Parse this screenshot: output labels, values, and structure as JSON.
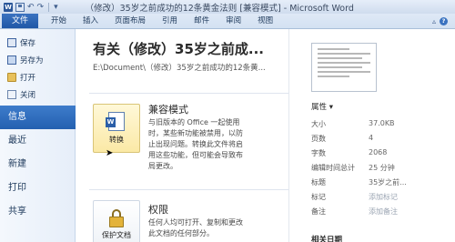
{
  "window": {
    "title": "（修改）35岁之前成功的12条黄金法则 [兼容模式] - Microsoft Word",
    "qat_icons": [
      "word-icon",
      "save-icon",
      "undo-icon",
      "redo-icon",
      "customize-icon"
    ]
  },
  "ribbon": {
    "file_tab": "文件",
    "tabs": [
      "开始",
      "插入",
      "页面布局",
      "引用",
      "邮件",
      "审阅",
      "视图"
    ]
  },
  "nav": {
    "commands": [
      {
        "label": "保存",
        "icon": "save-icon"
      },
      {
        "label": "另存为",
        "icon": "save-as-icon"
      },
      {
        "label": "打开",
        "icon": "open-folder-icon"
      },
      {
        "label": "关闭",
        "icon": "close-document-icon"
      }
    ],
    "tabs": [
      "信息",
      "最近",
      "新建",
      "打印",
      "共享"
    ],
    "active_tab": "信息"
  },
  "main": {
    "doc_title": "有关（修改）35岁之前成...",
    "doc_path": "E:\\Document\\（修改）35岁之前成功的12条黄...",
    "compat": {
      "button_label": "转换",
      "title": "兼容模式",
      "description": [
        "与旧版本的 Office 一起使用",
        "时，某些新功能被禁用，以防",
        "止出现问题。转换此文件将启",
        "用这些功能，但可能会导致布",
        "局更改。"
      ]
    },
    "permissions": {
      "button_label": "保护文档",
      "title": "权限",
      "description": [
        "任何人均可打开、复制和更改",
        "此文档的任何部分。"
      ]
    }
  },
  "properties": {
    "heading": "属性 ▾",
    "rows": [
      {
        "key": "大小",
        "value": "37.0KB",
        "faint": false
      },
      {
        "key": "页数",
        "value": "4",
        "faint": false
      },
      {
        "key": "字数",
        "value": "2068",
        "faint": false
      },
      {
        "key": "编辑时间总计",
        "value": "25 分钟",
        "faint": false
      },
      {
        "key": "标题",
        "value": "35岁之前...",
        "faint": false
      },
      {
        "key": "标记",
        "value": "添加标记",
        "faint": true
      },
      {
        "key": "备注",
        "value": "添加备注",
        "faint": true
      }
    ],
    "related_heading": "相关日期"
  },
  "colors": {
    "file_tab": "#2a62b0",
    "nav_active": "#2e6bbb",
    "compat_button": "#fbe9a6"
  }
}
